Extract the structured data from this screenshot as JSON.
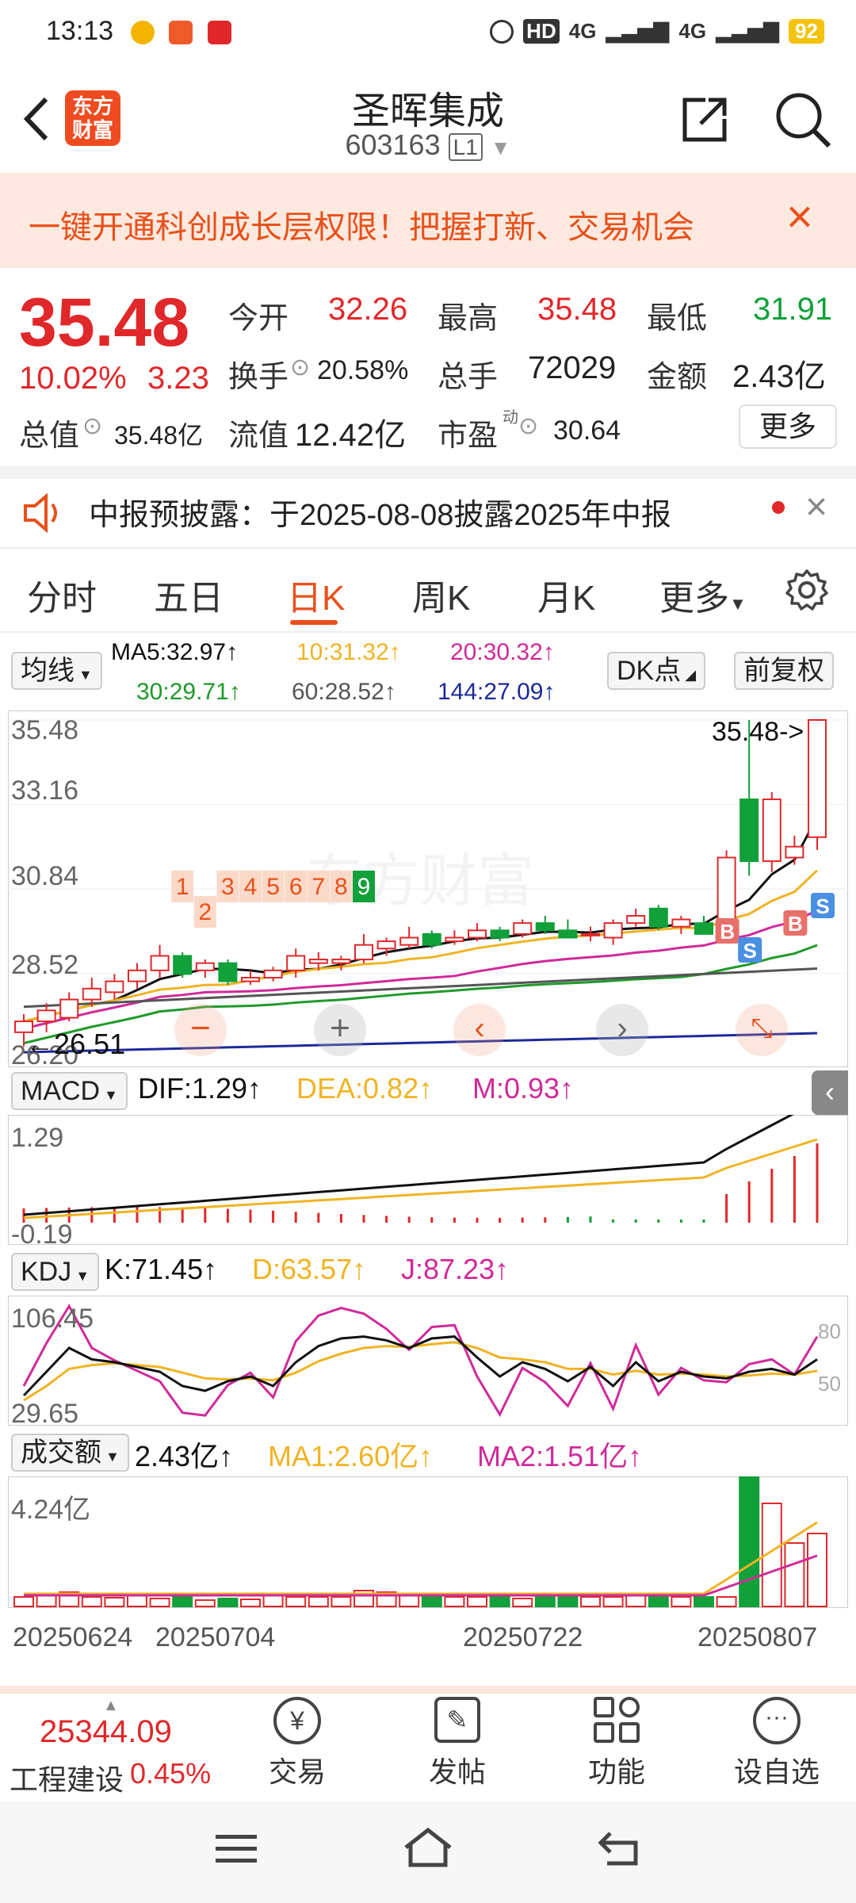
{
  "status_bar": {
    "time": "13:13",
    "network1": "4G",
    "network2": "4G",
    "battery": "92",
    "hd": "HD"
  },
  "header": {
    "back_icon": "chevron-left-icon",
    "logo": "东方\n财富",
    "title": "圣晖集成",
    "code": "603163",
    "level": "L1",
    "share_icon": "share-icon",
    "search_icon": "search-icon"
  },
  "banner": {
    "text": "一键开通科创成长层权限！把握打新、交易机会",
    "close": "×"
  },
  "quote": {
    "price": "35.48",
    "change_pct": "10.02%",
    "change": "3.23",
    "open_label": "今开",
    "open": "32.26",
    "high_label": "最高",
    "high": "35.48",
    "low_label": "最低",
    "low": "31.91",
    "turnover_label": "换手",
    "turnover": "20.58%",
    "volume_label": "总手",
    "volume": "72029",
    "amount_label": "金额",
    "amount": "2.43亿",
    "mktcap_label": "总值",
    "mktcap": "35.48亿",
    "float_label": "流值",
    "float": "12.42亿",
    "pe_label": "市盈",
    "pe_sup": "动",
    "pe": "30.64",
    "more": "更多"
  },
  "notice": {
    "text": "中报预披露：于2025-08-08披露2025年中报"
  },
  "tabs": [
    "分时",
    "五日",
    "日K",
    "周K",
    "月K",
    "更多"
  ],
  "active_tab": 2,
  "ma_bar": {
    "selector": "均线",
    "ma5": "MA5:32.97↑",
    "ma10": "10:31.32↑",
    "ma20": "20:30.32↑",
    "ma30": "30:29.71↑",
    "ma60": "60:28.52↑",
    "ma144": "144:27.09↑",
    "dk": "DK点",
    "fq": "前复权"
  },
  "colors": {
    "red": "#e0282a",
    "green": "#11a03a",
    "ma5": "#111111",
    "ma10": "#f0b323",
    "ma20": "#d02a9a",
    "ma30": "#1f9a2a",
    "ma60": "#555555",
    "ma144": "#1c2a9a"
  },
  "kline": {
    "y_ticks": [
      "35.48",
      "33.16",
      "30.84",
      "28.52",
      "26.20"
    ],
    "last_label": "35.48->",
    "low_label": "26.51",
    "watermark": "东方财富",
    "td_numbers": [
      "1",
      "2",
      "3",
      "4",
      "5",
      "6",
      "7",
      "8",
      "9"
    ],
    "signals": [
      "B",
      "S",
      "B",
      "S"
    ]
  },
  "macd": {
    "selector": "MACD",
    "dif": "DIF:1.29↑",
    "dea": "DEA:0.82↑",
    "m": "M:0.93↑",
    "top": "1.29",
    "bottom": "-0.19"
  },
  "kdj": {
    "selector": "KDJ",
    "k": "K:71.45↑",
    "d": "D:63.57↑",
    "j": "J:87.23↑",
    "top": "106.45",
    "bottom": "29.65",
    "r80": "80",
    "r50": "50"
  },
  "vol": {
    "selector": "成交额",
    "value": "2.43亿↑",
    "ma1": "MA1:2.60亿↑",
    "ma2": "MA2:1.51亿↑",
    "top": "4.24亿"
  },
  "dates": [
    "20250624",
    "20250704",
    "20250722",
    "20250807"
  ],
  "bottom_bar": {
    "index_value": "25344.09",
    "index_name": "工程建设",
    "index_pct": "0.45%",
    "trade": "交易",
    "post": "发帖",
    "func": "功能",
    "watch": "设自选"
  },
  "chart_data": {
    "type": "candlestick",
    "ylim": [
      26.2,
      35.48
    ],
    "candles": [
      {
        "o": 26.9,
        "h": 27.4,
        "l": 26.51,
        "c": 27.2
      },
      {
        "o": 27.2,
        "h": 27.7,
        "l": 26.9,
        "c": 27.5
      },
      {
        "o": 27.3,
        "h": 28.0,
        "l": 27.2,
        "c": 27.8
      },
      {
        "o": 27.8,
        "h": 28.4,
        "l": 27.6,
        "c": 28.1
      },
      {
        "o": 28.0,
        "h": 28.5,
        "l": 27.8,
        "c": 28.3
      },
      {
        "o": 28.3,
        "h": 28.8,
        "l": 28.1,
        "c": 28.6
      },
      {
        "o": 28.6,
        "h": 29.3,
        "l": 28.4,
        "c": 29.0
      },
      {
        "o": 29.0,
        "h": 29.1,
        "l": 28.4,
        "c": 28.5
      },
      {
        "o": 28.6,
        "h": 28.9,
        "l": 28.4,
        "c": 28.8
      },
      {
        "o": 28.8,
        "h": 28.9,
        "l": 28.2,
        "c": 28.3
      },
      {
        "o": 28.3,
        "h": 28.6,
        "l": 28.2,
        "c": 28.4
      },
      {
        "o": 28.4,
        "h": 28.7,
        "l": 28.3,
        "c": 28.6
      },
      {
        "o": 28.6,
        "h": 29.2,
        "l": 28.4,
        "c": 29.0
      },
      {
        "o": 28.8,
        "h": 29.1,
        "l": 28.6,
        "c": 28.9
      },
      {
        "o": 28.8,
        "h": 29.0,
        "l": 28.6,
        "c": 28.9
      },
      {
        "o": 28.9,
        "h": 29.6,
        "l": 28.8,
        "c": 29.3
      },
      {
        "o": 29.2,
        "h": 29.5,
        "l": 29.0,
        "c": 29.4
      },
      {
        "o": 29.3,
        "h": 29.8,
        "l": 29.2,
        "c": 29.5
      },
      {
        "o": 29.6,
        "h": 29.7,
        "l": 29.2,
        "c": 29.3
      },
      {
        "o": 29.4,
        "h": 29.7,
        "l": 29.3,
        "c": 29.5
      },
      {
        "o": 29.5,
        "h": 29.9,
        "l": 29.4,
        "c": 29.7
      },
      {
        "o": 29.7,
        "h": 29.8,
        "l": 29.4,
        "c": 29.5
      },
      {
        "o": 29.6,
        "h": 30.0,
        "l": 29.5,
        "c": 29.9
      },
      {
        "o": 29.9,
        "h": 30.1,
        "l": 29.6,
        "c": 29.7
      },
      {
        "o": 29.7,
        "h": 30.0,
        "l": 29.5,
        "c": 29.5
      },
      {
        "o": 29.6,
        "h": 29.8,
        "l": 29.4,
        "c": 29.6
      },
      {
        "o": 29.5,
        "h": 30.0,
        "l": 29.3,
        "c": 29.9
      },
      {
        "o": 29.9,
        "h": 30.3,
        "l": 29.8,
        "c": 30.1
      },
      {
        "o": 30.3,
        "h": 30.4,
        "l": 29.7,
        "c": 29.8
      },
      {
        "o": 29.8,
        "h": 30.1,
        "l": 29.6,
        "c": 30.0
      },
      {
        "o": 29.9,
        "h": 30.1,
        "l": 29.6,
        "c": 29.6
      },
      {
        "o": 29.7,
        "h": 31.9,
        "l": 29.6,
        "c": 31.7
      },
      {
        "o": 33.3,
        "h": 35.48,
        "l": 31.2,
        "c": 31.6
      },
      {
        "o": 31.6,
        "h": 33.5,
        "l": 31.3,
        "c": 33.3
      },
      {
        "o": 31.7,
        "h": 32.3,
        "l": 31.5,
        "c": 32.0
      },
      {
        "o": 32.26,
        "h": 35.48,
        "l": 31.91,
        "c": 35.48
      }
    ]
  }
}
